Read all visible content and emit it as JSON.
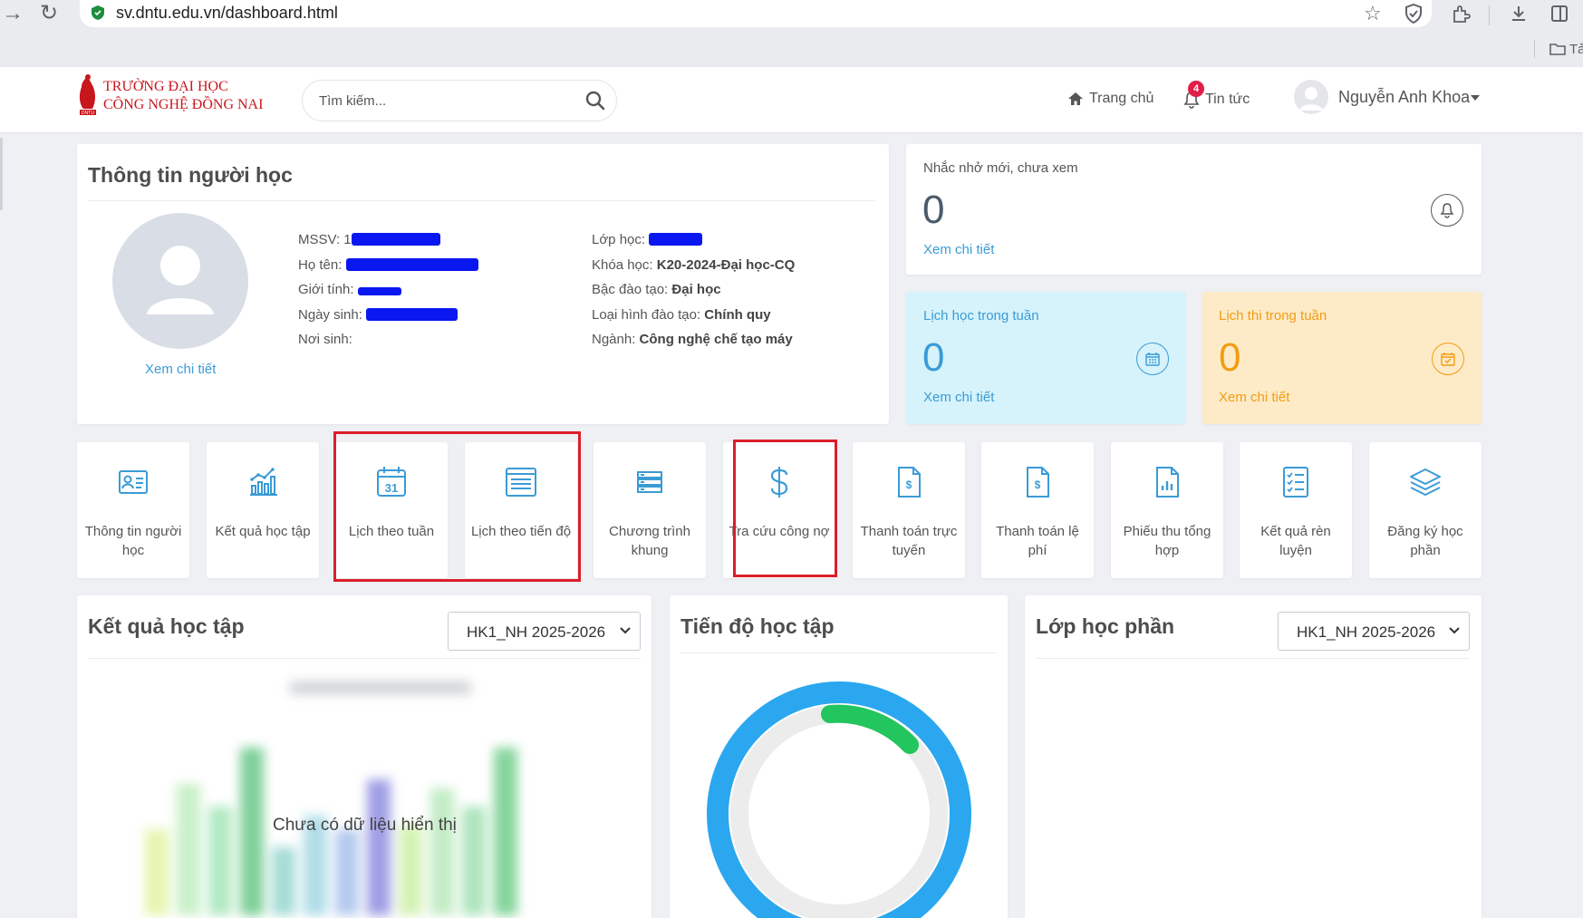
{
  "browser": {
    "url": "sv.dntu.edu.vn/dashboard.html",
    "bookmark_text": "Tả"
  },
  "header": {
    "logo_line1": "TRƯỜNG ĐẠI HỌC",
    "logo_line2": "CÔNG NGHỆ ĐỒNG NAI",
    "logo_badge": "DNTU",
    "search_placeholder": "Tìm kiếm...",
    "nav_home": "Trang chủ",
    "nav_news": "Tin tức",
    "news_badge": "4",
    "user_name": "Nguyễn Anh Khoa"
  },
  "student": {
    "title": "Thông tin người học",
    "view_detail": "Xem chi tiết",
    "mssv_label": "MSSV:",
    "mssv_value": "1",
    "name_label": "Họ tên:",
    "gender_label": "Giới tính:",
    "dob_label": "Ngày sinh:",
    "pob_label": "Nơi sinh:",
    "class_label": "Lớp học:",
    "course_label": "Khóa học:",
    "course_value": "K20-2024-Đại học-CQ",
    "level_label": "Bậc đào tạo:",
    "level_value": "Đại học",
    "type_label": "Loại hình đào tạo:",
    "type_value": "Chính quy",
    "major_label": "Ngành:",
    "major_value": "Công nghệ chế tạo máy"
  },
  "stats": {
    "reminders": {
      "label": "Nhắc nhở mới, chưa xem",
      "value": "0",
      "link": "Xem chi tiết"
    },
    "schedule": {
      "label": "Lịch học trong tuần",
      "value": "0",
      "link": "Xem chi tiết"
    },
    "exams": {
      "label": "Lịch thi trong tuần",
      "value": "0",
      "link": "Xem chi tiết"
    }
  },
  "tiles": [
    {
      "label": "Thông tin người học",
      "icon": "id-card-icon"
    },
    {
      "label": "Kết quả học tập",
      "icon": "bar-chart-icon"
    },
    {
      "label": "Lịch theo tuần",
      "icon": "calendar-31-icon",
      "calendar_day": "31"
    },
    {
      "label": "Lịch theo tiến độ",
      "icon": "list-document-icon"
    },
    {
      "label": "Chương trình khung",
      "icon": "server-stack-icon"
    },
    {
      "label": "Tra cứu công nợ",
      "icon": "dollar-icon"
    },
    {
      "label": "Thanh toán trực tuyến",
      "icon": "invoice-dollar-icon"
    },
    {
      "label": "Thanh toán lệ phí",
      "icon": "invoice-dollar-icon"
    },
    {
      "label": "Phiếu thu tổng hợp",
      "icon": "document-chart-icon"
    },
    {
      "label": "Kết quả rèn luyện",
      "icon": "checklist-icon"
    },
    {
      "label": "Đăng ký học phần",
      "icon": "layers-icon"
    }
  ],
  "results": {
    "title": "Kết quả học tập",
    "semester": "HK1_NH 2025-2026",
    "empty_message": "Chưa có dữ liệu hiển thị"
  },
  "progress": {
    "title": "Tiến độ học tập"
  },
  "sections": {
    "title": "Lớp học phần",
    "semester": "HK1_NH 2025-2026"
  },
  "colors": {
    "brand_red": "#c8161d",
    "link_blue": "#3b9bd6",
    "info_card_bg": "#d6f3fb",
    "exam_card_bg": "#fdebc8",
    "exam_orange": "#f39c12",
    "highlight_red": "#dc1e2a",
    "ring_blue": "#2ba7ef",
    "ring_green": "#22c55e"
  }
}
